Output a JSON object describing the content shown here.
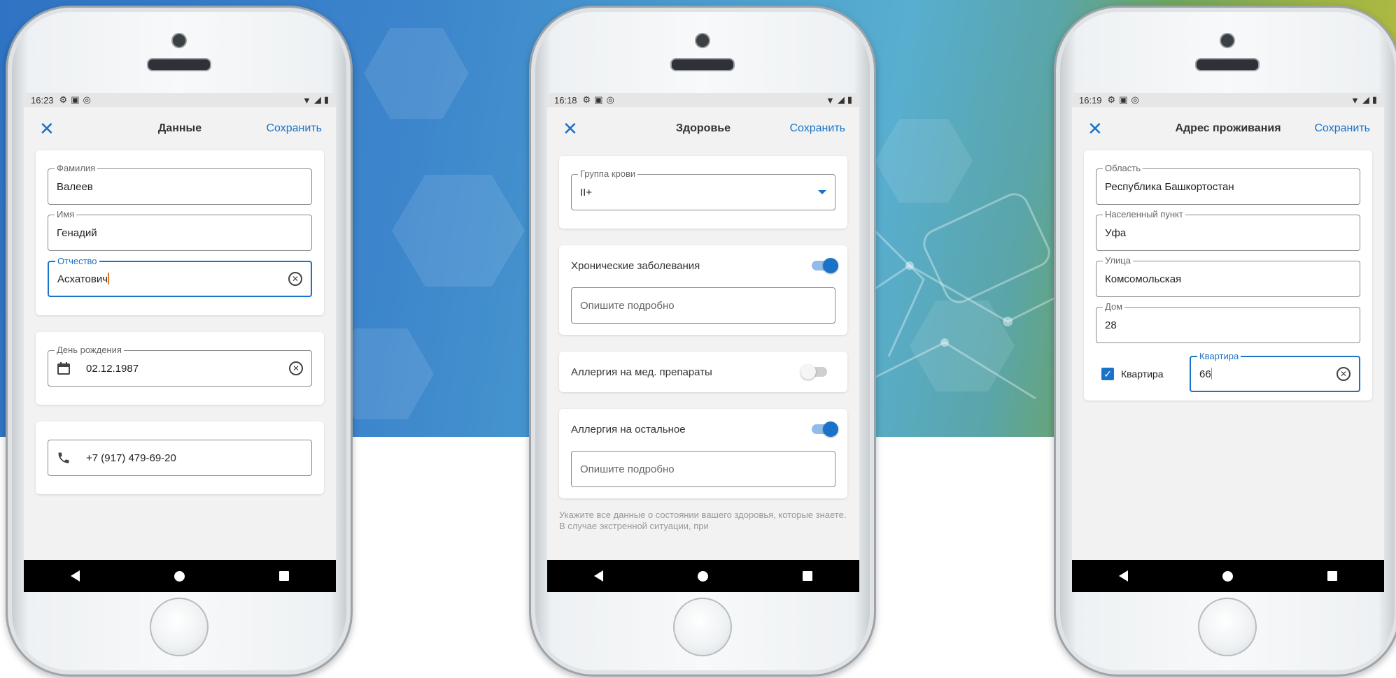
{
  "phones": [
    {
      "status": {
        "time": "16:23"
      },
      "appbar": {
        "title": "Данные",
        "save": "Сохранить"
      },
      "fields": {
        "lastname": {
          "label": "Фамилия",
          "value": "Валеев"
        },
        "firstname": {
          "label": "Имя",
          "value": "Генадий"
        },
        "patronymic": {
          "label": "Отчество",
          "value": "Асхатович"
        },
        "birthday": {
          "label": "День рождения",
          "value": "02.12.1987"
        },
        "phone": {
          "value": "+7 (917) 479-69-20"
        }
      }
    },
    {
      "status": {
        "time": "16:18"
      },
      "appbar": {
        "title": "Здоровье",
        "save": "Сохранить"
      },
      "blood": {
        "label": "Группа крови",
        "value": "II+"
      },
      "chronic": {
        "label": "Хронические заболевания",
        "on": true,
        "placeholder": "Опишите подробно"
      },
      "allergy_med": {
        "label": "Аллергия на мед. препараты",
        "on": false
      },
      "allergy_other": {
        "label": "Аллергия на остальное",
        "on": true,
        "placeholder": "Опишите подробно"
      },
      "note": "Укажите все данные о состоянии вашего здоровья, которые знаете. В случае экстренной ситуации, при"
    },
    {
      "status": {
        "time": "16:19"
      },
      "appbar": {
        "title": "Адрес проживания",
        "save": "Сохранить"
      },
      "fields": {
        "region": {
          "label": "Область",
          "value": "Республика Башкортостан"
        },
        "city": {
          "label": "Населенный пункт",
          "value": "Уфа"
        },
        "street": {
          "label": "Улица",
          "value": "Комсомольская"
        },
        "house": {
          "label": "Дом",
          "value": "28"
        },
        "apartment": {
          "label": "Квартира",
          "value": "66"
        }
      },
      "apartment_checkbox": {
        "label": "Квартира",
        "checked": true
      }
    }
  ],
  "colors": {
    "accent": "#1a73c8",
    "caret": "#e8731a"
  }
}
